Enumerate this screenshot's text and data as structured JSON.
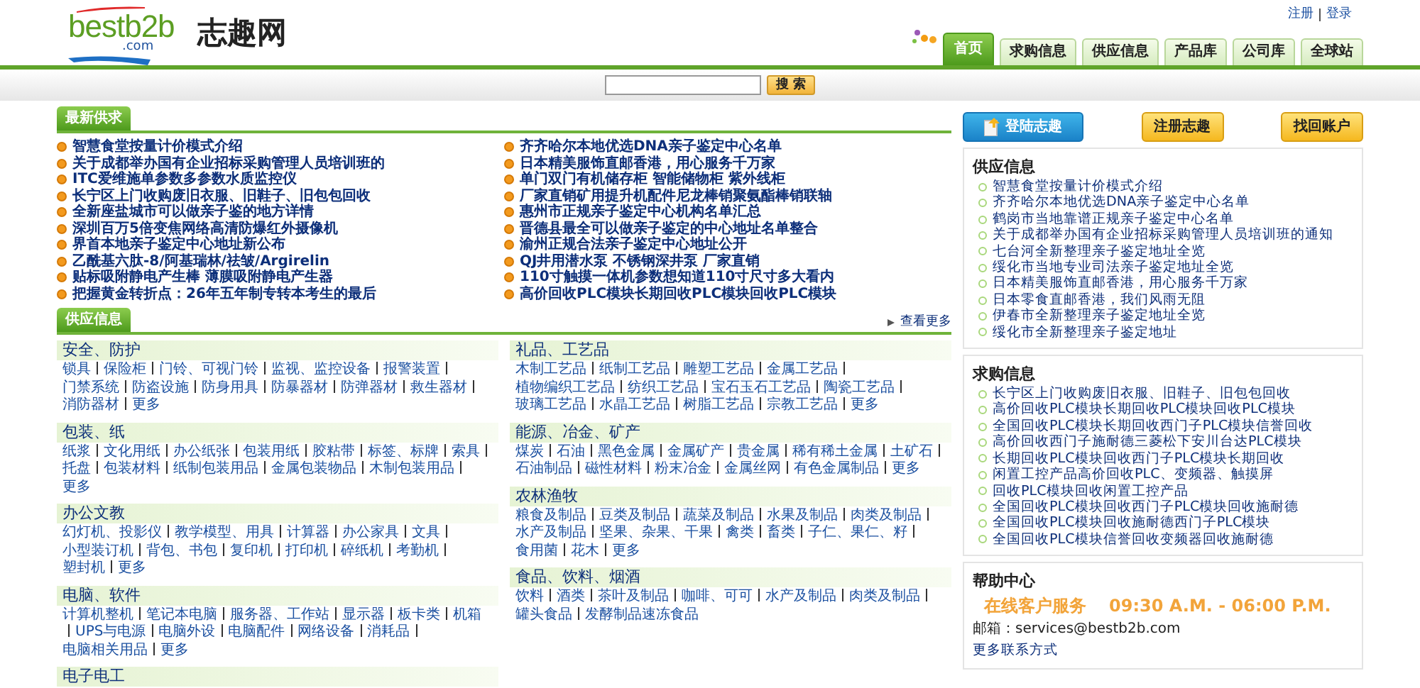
{
  "header": {
    "logo": {
      "text": "bestb2b",
      "sub": ".com"
    },
    "site_name": "志趣网",
    "user_links": [
      "注册",
      "登录"
    ],
    "tabs": [
      {
        "label": "首页",
        "selected": true
      },
      {
        "label": "求购信息",
        "selected": false
      },
      {
        "label": "供应信息",
        "selected": false
      },
      {
        "label": "产品库",
        "selected": false
      },
      {
        "label": "公司库",
        "selected": false
      },
      {
        "label": "全球站",
        "selected": false
      }
    ]
  },
  "search": {
    "button": "搜 索"
  },
  "latest": {
    "title": "最新供求",
    "columns": [
      {
        "items": [
          "智慧食堂按量计价模式介绍",
          "关于成都举办国有企业招标采购管理人员培训班的",
          "ITC爱维施单参数多参数水质监控仪",
          "长宁区上门收购废旧衣服、旧鞋子、旧包包回收",
          "全新座盐城市可以做亲子鉴的地方详情",
          "深圳百万5倍变焦网络高清防爆红外摄像机",
          "界首本地亲子鉴定中心地址新公布",
          "乙酰基六肽-8/阿基瑞林/祛皱/Argirelin",
          "贴标吸附静电产生棒 薄膜吸附静电产生器",
          "把握黄金转折点：26年五年制专转本考生的最后"
        ]
      },
      {
        "items": [
          "齐齐哈尔本地优选DNA亲子鉴定中心名单",
          "日本精美服饰直邮香港，用心服务千万家",
          "单门双门有机储存柜 智能储物柜 紫外线柜",
          "厂家直销矿用提升机配件尼龙棒销聚氨酯棒销联轴",
          "惠州市正规亲子鉴定中心机构名单汇总",
          "晋德县最全可以做亲子鉴定的中心地址名单整合",
          "渝州正规合法亲子鉴定中心地址公开",
          "QJ井用潜水泵 不锈钢深井泵 厂家直销",
          "110寸触摸一体机参数想知道110寸尺寸多大看内",
          "高价回收PLC模块长期回收PLC模块回收PLC模块"
        ]
      }
    ]
  },
  "supply": {
    "title": "供应信息",
    "more": "查看更多",
    "columns": [
      {
        "categories": [
          {
            "title": "安全、防护",
            "links": [
              "锁具",
              "保险柜",
              "门铃、可视门铃",
              "监视、监控设备",
              "报警装置",
              "门禁系统",
              "防盗设施",
              "防身用具",
              "防暴器材",
              "防弹器材",
              "救生器材",
              "消防器材",
              "更多"
            ]
          },
          {
            "title": "包装、纸",
            "links": [
              "纸浆",
              "文化用纸",
              "办公纸张",
              "包装用纸",
              "胶粘带",
              "标签、标牌",
              "索具",
              "托盘",
              "包装材料",
              "纸制包装用品",
              "金属包装物品",
              "木制包装用品",
              "更多"
            ]
          },
          {
            "title": "办公文教",
            "links": [
              "幻灯机、投影仪",
              "教学模型、用具",
              "计算器",
              "办公家具",
              "文具",
              "小型装订机",
              "背包、书包",
              "复印机",
              "打印机",
              "碎纸机",
              "考勤机",
              "塑封机",
              "更多"
            ]
          },
          {
            "title": "电脑、软件",
            "links": [
              "计算机整机",
              "笔记本电脑",
              "服务器、工作站",
              "显示器",
              "板卡类",
              "机箱",
              "UPS与电源",
              "电脑外设",
              "电脑配件",
              "网络设备",
              "消耗品",
              "电脑相关用品",
              "更多"
            ]
          },
          {
            "title": "电子电工"
          }
        ]
      },
      {
        "categories": [
          {
            "title": "礼品、工艺品",
            "links": [
              "木制工艺品",
              "纸制工艺品",
              "雕塑工艺品",
              "金属工艺品",
              "植物编织工艺品",
              "纺织工艺品",
              "宝石玉石工艺品",
              "陶瓷工艺品",
              "玻璃工艺品",
              "水晶工艺品",
              "树脂工艺品",
              "宗教工艺品",
              "更多"
            ]
          },
          {
            "title": "能源、冶金、矿产",
            "links": [
              "煤炭",
              "石油",
              "黑色金属",
              "金属矿产",
              "贵金属",
              "稀有稀土金属",
              "土矿石",
              "石油制品",
              "磁性材料",
              "粉末冶金",
              "金属丝网",
              "有色金属制品",
              "更多"
            ]
          },
          {
            "title": "农林渔牧",
            "links": [
              "粮食及制品",
              "豆类及制品",
              "蔬菜及制品",
              "水果及制品",
              "肉类及制品",
              "水产及制品",
              "坚果、杂果、干果",
              "禽类",
              "畜类",
              "子仁、果仁、籽",
              "食用菌",
              "花木",
              "更多"
            ]
          },
          {
            "title": "食品、饮料、烟酒",
            "links": [
              "饮料",
              "酒类",
              "茶叶及制品",
              "咖啡、可可",
              "水产及制品",
              "肉类及制品",
              "罐头食品",
              "发酵制品速冻食品"
            ]
          }
        ]
      }
    ]
  },
  "account_buttons": [
    {
      "label": "登陆志趣",
      "kind": "primary"
    },
    {
      "label": "注册志趣",
      "kind": "secondary"
    },
    {
      "label": "找回账户",
      "kind": "secondary"
    }
  ],
  "supply_info": {
    "title": "供应信息",
    "items": [
      "智慧食堂按量计价模式介绍",
      "齐齐哈尔本地优选DNA亲子鉴定中心名单",
      "鹤岗市当地靠谱正规亲子鉴定中心名单",
      "关于成都举办国有企业招标采购管理人员培训班的通知",
      "七台河全新整理亲子鉴定地址全览",
      "绥化市当地专业司法亲子鉴定地址全览",
      "日本精美服饰直邮香港，用心服务千万家",
      "日本零食直邮香港，我们风雨无阻",
      "伊春市全新整理亲子鉴定地址全览",
      "绥化市全新整理亲子鉴定地址"
    ]
  },
  "buy_info": {
    "title": "求购信息",
    "items": [
      "长宁区上门收购废旧衣服、旧鞋子、旧包包回收",
      "高价回收PLC模块长期回收PLC模块回收PLC模块",
      "全国回收PLC模块长期回收西门子PLC模块信誉回收",
      "高价回收西门子施耐德三菱松下安川台达PLC模块",
      "长期回收PLC模块回收西门子PLC模块长期回收",
      "闲置工控产品高价回收PLC、变频器、触摸屏",
      "回收PLC模块回收闲置工控产品",
      "全国回收PLC模块回收西门子PLC模块回收施耐德",
      "全国回收PLC模块回收施耐德西门子PLC模块",
      "全国回收PLC模块信誉回收变频器回收施耐德"
    ]
  },
  "help": {
    "title": "帮助中心",
    "service": "在线客户服务",
    "hours": "09:30 A.M. - 06:00 P.M.",
    "email": "邮箱：services@bestb2b.com",
    "more": "更多联系方式"
  }
}
